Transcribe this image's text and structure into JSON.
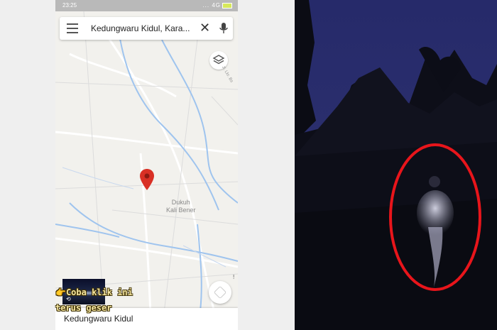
{
  "status_bar": {
    "time": "23:25",
    "icons": "... 4G"
  },
  "search": {
    "query": "Kedungwaru Kidul, Kara..."
  },
  "map": {
    "place_label_line1": "Dukuh",
    "place_label_line2": "Kali Bener",
    "road_label": "Jl. Lkr. Bs"
  },
  "overlay": {
    "line1": "Coba klik ini",
    "line2": "terus geser"
  },
  "bottom_card": {
    "title": "Kedungwaru Kidul"
  },
  "fab": {
    "badge": "!"
  },
  "colors": {
    "pin": "#d93025",
    "water": "#9fc4ee",
    "highlight_ring": "#e8151b"
  },
  "icons": [
    "menu-icon",
    "close-icon",
    "mic-icon",
    "layers-icon",
    "map-pin-icon",
    "directions-icon",
    "pointing-hand-icon"
  ]
}
